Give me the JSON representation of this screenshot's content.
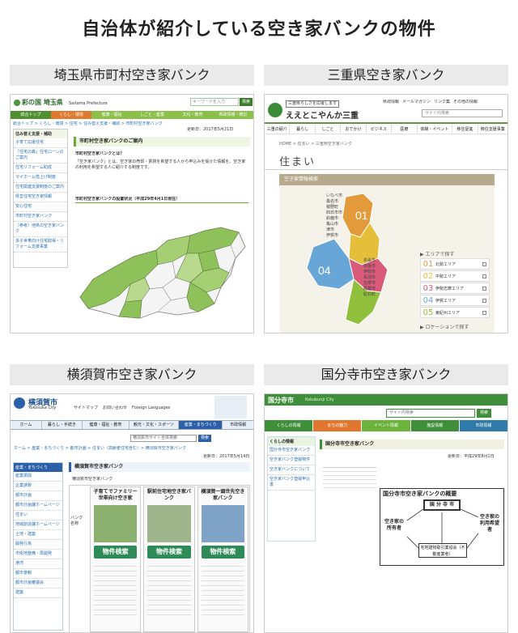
{
  "title": "自治体が紹介している空き家バンクの物件",
  "panels": [
    {
      "caption": "埼玉県市町村空き家バンク",
      "logo": "彩の国 埼玉県",
      "logo_sub": "Saitama Prefecture",
      "search_placeholder": "キーワードを入力",
      "search_btn": "検索",
      "nav": [
        "総合トップ",
        "くらし・環境",
        "健康・福祉",
        "しごと・産業",
        "文化・教育",
        "県政情報・統計"
      ],
      "breadcrumb": "総合トップ > くらし・環境 > 住宅 > 住み替え支援・補助 > 市町村空き家バンク",
      "side_title": "住み替え支援・補助",
      "side_items": [
        "子育て応援住宅",
        "「住宅の森」住宅ローンのご案内",
        "住宅リフォーム助成",
        "マイホーム借上げ制度",
        "住宅関連支援制度のご案内",
        "県営住宅空き家情報",
        "安心住宅",
        "市町村空き家バンク",
        "（参考）他県の空き家バンク",
        "多子世帯向け住宅取得・リフォーム支援事業"
      ],
      "heading": "市町村空き家バンクのご案内",
      "sub1": "市町村空き家バンクとは？",
      "body": "「空き家バンク」とは、空き家の売却・賃貸を希望する人から申込みを受けた情報を、空き家の利用を希望する人に紹介する制度です。",
      "sub2": "市町村空き家バンクの設置状況（平成29年4月1日現在）",
      "updated": "更新日：2017年5月21日"
    },
    {
      "caption": "三重県空き家バンク",
      "logo": "ええとこやんか三重",
      "logo_tag": "三重県らしさを応援します",
      "links": [
        "県政情報",
        "メールマガジン",
        "リンク集",
        "その他の情報"
      ],
      "search_placeholder": "サイト内検索",
      "nav": [
        "三重の紹介",
        "暮らし",
        "しごと",
        "おでかけ",
        "ビジネス",
        "医療",
        "体験・イベント",
        "移住促進",
        "移住支援事業"
      ],
      "breadcrumb": "HOME > 住まい > 三重県空き家バンク",
      "page_title": "住まい",
      "banner": "空き家情報検索",
      "area_title": "エリアで探す",
      "areas": [
        {
          "num": "01",
          "name": "北勢エリア",
          "color": "#e39a3a"
        },
        {
          "num": "02",
          "name": "中勢エリア",
          "color": "#e5bf3a"
        },
        {
          "num": "03",
          "name": "伊勢志摩エリア",
          "color": "#d95a79"
        },
        {
          "num": "04",
          "name": "伊賀エリア",
          "color": "#68a6d8"
        },
        {
          "num": "05",
          "name": "東紀州エリア",
          "color": "#8fbf3b"
        }
      ],
      "location": "ロケーションで探す",
      "map_labels": [
        "いなべ市",
        "桑名市",
        "菰野町",
        "四日市市",
        "鈴鹿市",
        "亀山市",
        "津市",
        "伊賀市",
        "名張市",
        "松阪市",
        "伊勢市",
        "鳥羽市",
        "志摩市",
        "尾鷲市",
        "紀北町"
      ]
    },
    {
      "caption": "横須賀市空き家バンク",
      "logo": "横須賀市",
      "logo_sub": "Yokosuka City",
      "links": [
        "サイトマップ",
        "お問い合わせ",
        "Foreign Languages"
      ],
      "nav": [
        "ホーム",
        "暮らし・手続き",
        "健康・福祉・教育",
        "観光・文化・スポーツ",
        "産業・まちづくり",
        "市政情報"
      ],
      "search_placeholder": "横須賀市サイト全体検索",
      "search_btn": "検索",
      "breadcrumb": "ホーム > 産業・まちづくり > 都市計画 > 住まい（高齢者住宅含む）> 横須賀市空き家バンク",
      "updated": "更新日：2017年5月14日",
      "side_title": "産業・まちづくり",
      "side_items": [
        "産業振興",
        "企業誘致",
        "都市計画",
        "都市計画課ホームページ",
        "住まい",
        "地域創造課ホームページ",
        "土地・建築",
        "開発行為",
        "市街地整備・再開発",
        "港湾",
        "都市景観",
        "都市計画審議会",
        "建築"
      ],
      "heading": "横須賀市空き家バンク",
      "sub": "横須賀市空き家バンク",
      "cards": [
        {
          "title": "子育てでファミリー世帯向け空き家",
          "btn": "物件検索"
        },
        {
          "title": "駅前住宅地空き家バンク",
          "btn": "物件検索"
        },
        {
          "title": "横須賀一頭世先空き家バンク",
          "btn": "物件検索"
        }
      ],
      "bank_label": "バンク名称"
    },
    {
      "caption": "国分寺市空き家バンク",
      "logo": "国分寺市",
      "logo_sub": "Kokubunji City",
      "search_placeholder": "サイト内検索",
      "search_btn": "検索",
      "nav": [
        "くらしの情報",
        "まちの魅力",
        "イベント情報",
        "施設情報",
        "市政情報"
      ],
      "side_title": "くらしの情報",
      "heading": "国分寺市空き家バンク",
      "diagram_title": "国分寺市空き家バンクの概要",
      "center": "国 分 寺 市",
      "left": "空き家の所有者",
      "right": "空き家の利用希望者",
      "org": "宅地建物取引業協会（不動産業者）",
      "updated": "更新日：平成29年8月1日",
      "left_links": [
        "国分寺市空き家バンク",
        "空き家バンク登録物件",
        "空き家バンクについて",
        "空き家バンク登録申込書"
      ]
    }
  ]
}
